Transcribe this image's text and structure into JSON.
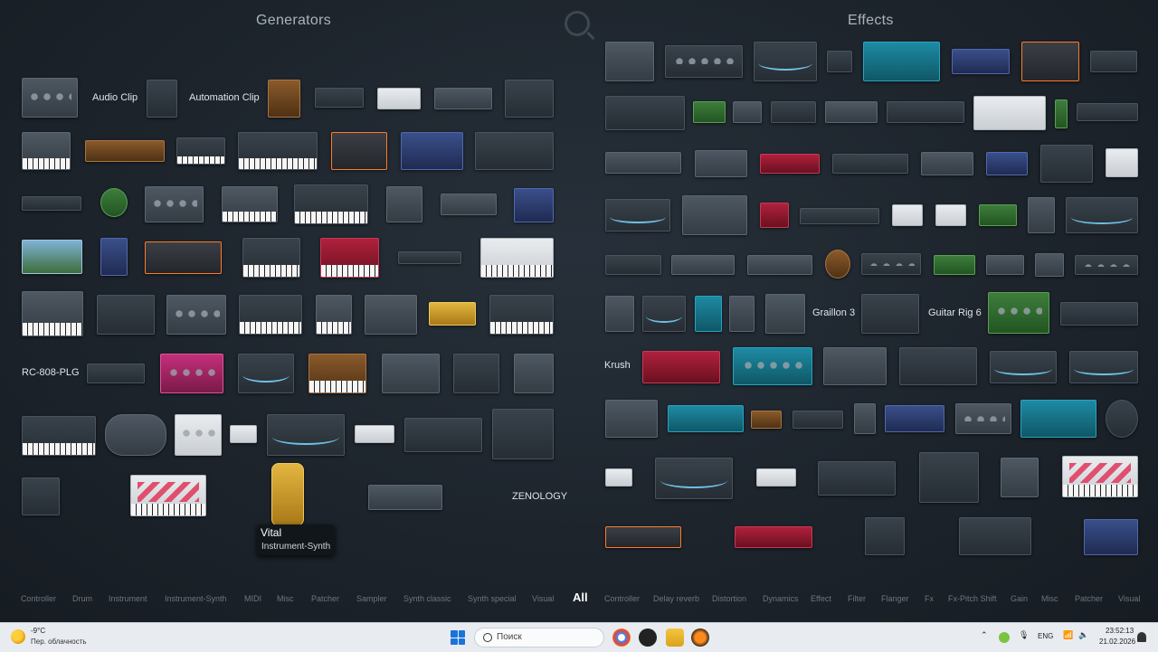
{
  "headers": {
    "generators": "Generators",
    "effects": "Effects"
  },
  "labels": {
    "audio_clip": "Audio Clip",
    "automation_clip": "Automation Clip",
    "rc808": "RC-808-PLG",
    "zenology": "ZENOLOGY",
    "graillon": "Graillon 3",
    "guitar_rig": "Guitar Rig 6",
    "krush": "Krush"
  },
  "tooltip": {
    "title": "Vital",
    "subtitle": "Instrument-Synth"
  },
  "categories": {
    "generators": [
      "Controller",
      "Drum",
      "Instrument",
      "Instrument-Synth",
      "MIDI",
      "Misc",
      "Patcher",
      "Sampler",
      "Synth classic",
      "Synth special",
      "Visual"
    ],
    "all": "All",
    "effects": [
      "Controller",
      "Delay reverb",
      "Distortion",
      "Dynamics",
      "Effect",
      "Filter",
      "Flanger",
      "Fx",
      "Fx-Pitch Shift",
      "Gain",
      "Misc",
      "Patcher",
      "Visual"
    ]
  },
  "taskbar": {
    "weather_temp": "-9°C",
    "weather_desc": "Пер. облачность",
    "search_placeholder": "Поиск",
    "language": "ENG",
    "time": "23:52:13",
    "date": "21.02.2026"
  },
  "icons": {
    "search": "search-icon",
    "windows": "windows-start-icon",
    "weather": "weather-icon",
    "bell": "notification-icon"
  }
}
